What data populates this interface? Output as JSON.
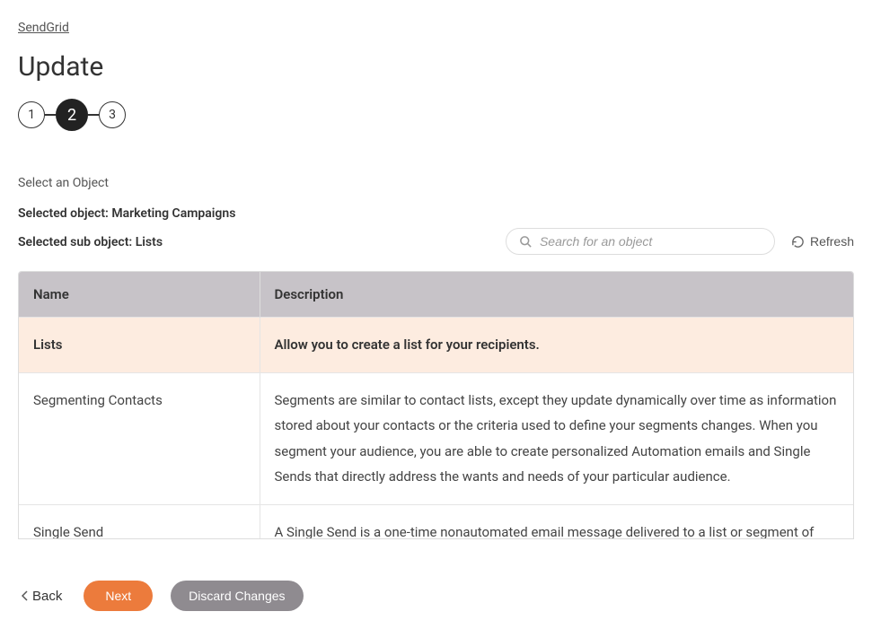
{
  "breadcrumb": "SendGrid",
  "page_title": "Update",
  "stepper": {
    "steps": [
      "1",
      "2",
      "3"
    ],
    "active_index": 1
  },
  "section_label": "Select an Object",
  "selected_object_label": "Selected object: Marketing Campaigns",
  "selected_sub_object_label": "Selected sub object: Lists",
  "search": {
    "placeholder": "Search for an object"
  },
  "refresh_label": "Refresh",
  "table": {
    "headers": {
      "name": "Name",
      "description": "Description"
    },
    "rows": [
      {
        "name": "Lists",
        "description": "Allow you to create a list for your recipients.",
        "selected": true
      },
      {
        "name": "Segmenting Contacts",
        "description": "Segments are similar to contact lists, except they update dynamically over time as information stored about your contacts or the criteria used to define your segments changes. When you segment your audience, you are able to create personalized Automation emails and Single Sends that directly address the wants and needs of your particular audience.",
        "selected": false
      },
      {
        "name": "Single Send",
        "description": "A Single Send is a one-time nonautomated email message delivered to a list or segment of your audience. A Single Send may be sent immediately or scheduled for future delivery. Single Sends",
        "selected": false
      }
    ]
  },
  "footer": {
    "back": "Back",
    "next": "Next",
    "discard": "Discard Changes"
  }
}
